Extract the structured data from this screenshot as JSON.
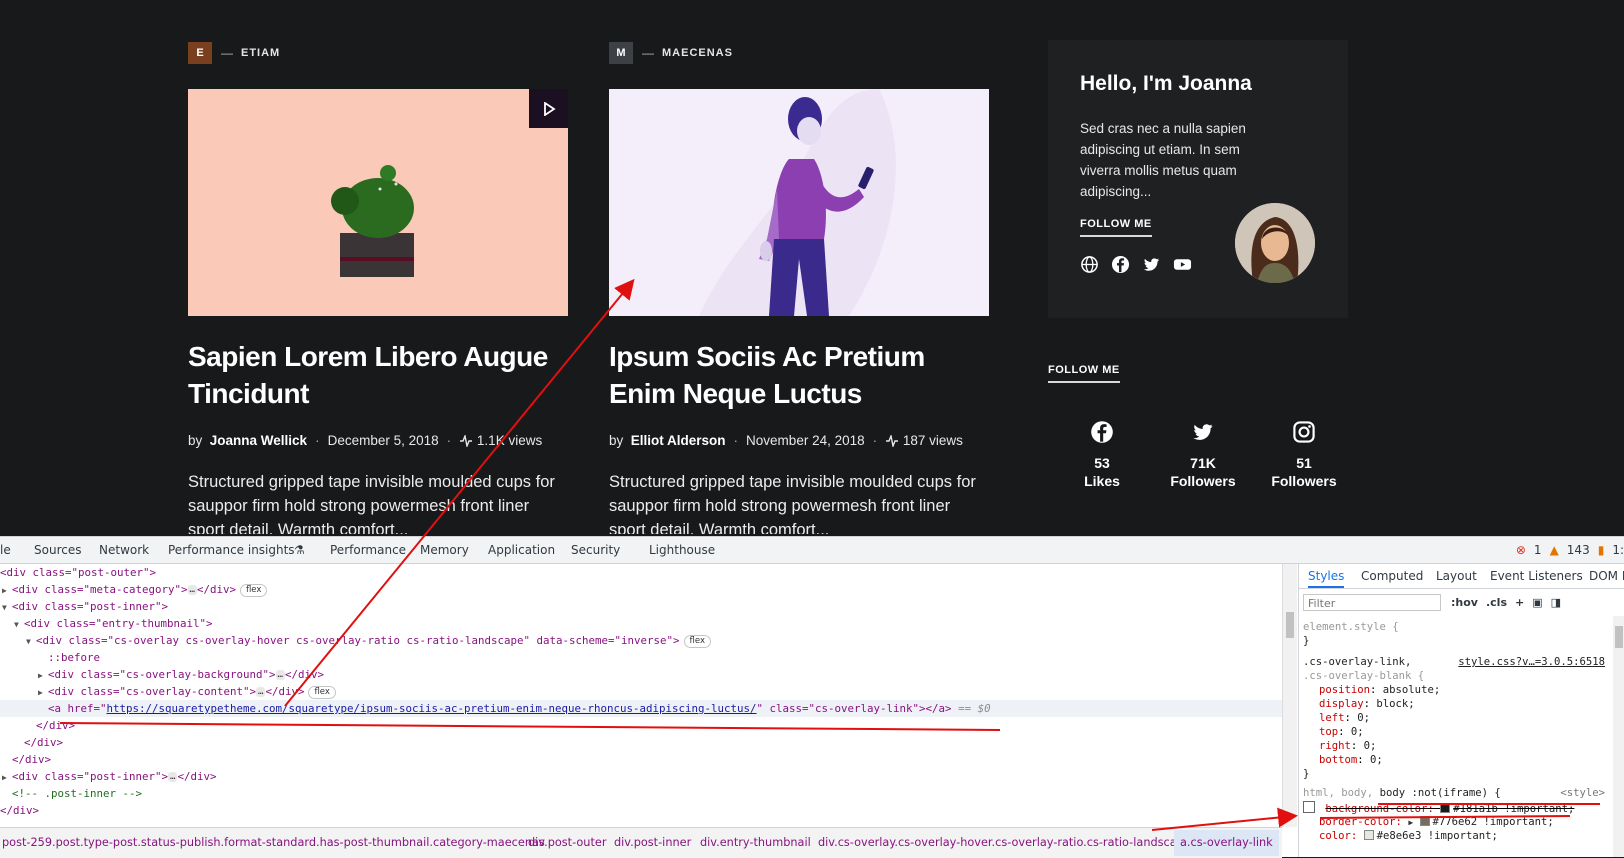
{
  "posts": [
    {
      "category_letter": "E",
      "category_color": "#7a3f1f",
      "category": "ETIAM",
      "title": "Sapien Lorem Libero Augue Tincidunt",
      "by": "by",
      "author": "Joanna Wellick",
      "date": "December 5, 2018",
      "views": "1.1K views",
      "excerpt": "Structured gripped tape invisible moulded cups for sauppor firm hold strong powermesh front liner sport detail. Warmth comfort..."
    },
    {
      "category_letter": "M",
      "category_color": "#3d4145",
      "category": "MAECENAS",
      "title": "Ipsum Sociis Ac Pretium Enim Neque Luctus",
      "by": "by",
      "author": "Elliot Alderson",
      "date": "November 24, 2018",
      "views": "187 views",
      "excerpt": "Structured gripped tape invisible moulded cups for sauppor firm hold strong powermesh front liner sport detail. Warmth comfort..."
    }
  ],
  "sidebar": {
    "title": "Hello, I'm Joanna",
    "text": "Sed cras nec a nulla sapien adipiscing ut etiam. In sem viverra mollis metus quam adipiscing...",
    "follow_label": "FOLLOW ME",
    "icons": [
      "globe-icon",
      "facebook-icon",
      "twitter-icon",
      "youtube-icon"
    ]
  },
  "follow_widget": {
    "title": "FOLLOW ME",
    "counters": [
      {
        "icon": "facebook-icon",
        "count": "53",
        "label": "Likes"
      },
      {
        "icon": "twitter-icon",
        "count": "71K",
        "label": "Followers"
      },
      {
        "icon": "instagram-icon",
        "count": "51",
        "label": "Followers"
      }
    ]
  },
  "devtools": {
    "tabs": [
      "le",
      "Sources",
      "Network",
      "Performance insights",
      "Performance",
      "Memory",
      "Application",
      "Security",
      "Lighthouse"
    ],
    "errors": "1",
    "warnings": "143",
    "info": "1:",
    "dom": {
      "l1": "<div class=\"post-outer\">",
      "l2a": "<div class=\"meta-category\">",
      "l2b": "</div>",
      "l3": "<div class=\"post-inner\">",
      "l4": "<div class=\"entry-thumbnail\">",
      "l5a": "<div class=\"cs-overlay cs-overlay-hover cs-overlay-ratio cs-ratio-landscape\" data-scheme=\"inverse\">",
      "l6": "::before",
      "l7a": "<div class=\"cs-overlay-background\">",
      "l7b": "</div>",
      "l8a": "<div class=\"cs-overlay-content\">",
      "l8b": "</div>",
      "l9_open": "<a href=\"",
      "l9_url": "https://squaretypetheme.com/squaretype/ipsum-sociis-ac-pretium-enim-neque-rhoncus-adipiscing-luctus/",
      "l9_mid": "\" class=\"cs-overlay-link\"></a>",
      "l9_eq": " == $0",
      "l10": "</div>",
      "l11": "</div>",
      "l12": "</div>",
      "l13a": "<div class=\"post-inner\">",
      "l13b": "</div>",
      "l14": "<!-- .post-inner -->",
      "l15": "</div>",
      "badge_flex": "flex",
      "dots": "…"
    },
    "breadcrumbs": [
      "post-259.post.type-post.status-publish.format-standard.has-post-thumbnail.category-maecenas",
      "div.post-outer",
      "div.post-inner",
      "div.entry-thumbnail",
      "div.cs-overlay.cs-overlay-hover.cs-overlay-ratio.cs-ratio-landscape",
      "a.cs-overlay-link"
    ],
    "styles": {
      "tabs": [
        "Styles",
        "Computed",
        "Layout",
        "Event Listeners",
        "DOM B"
      ],
      "filter_placeholder": "Filter",
      "hov": ":hov",
      "cls": ".cls",
      "element_style": "element.style {",
      "close": "}",
      "rule1_sel": ".cs-overlay-link,",
      "rule1_src": "style.css?v…=3.0.5:6518",
      "rule1_sel2": ".cs-overlay-blank {",
      "rule1_props": [
        {
          "p": "position",
          "v": "absolute;"
        },
        {
          "p": "display",
          "v": "block;"
        },
        {
          "p": "left",
          "v": "0;"
        },
        {
          "p": "top",
          "v": "0;"
        },
        {
          "p": "right",
          "v": "0;"
        },
        {
          "p": "bottom",
          "v": "0;"
        }
      ],
      "rule2_sel_a": "html, body,",
      "rule2_sel_b": "body :not(iframe) {",
      "rule2_src": "<style>",
      "rule2_p1": "background-color:",
      "rule2_v1": "#181a1b !important;",
      "rule2_c1": "#181a1b",
      "rule2_p2": "border-color:",
      "rule2_v2": "#776e62 !important;",
      "rule2_c2": "#776e62",
      "rule2_p3": "color:",
      "rule2_v3": "#e8e6e3 !important;",
      "rule2_c3": "#e8e6e3"
    }
  }
}
